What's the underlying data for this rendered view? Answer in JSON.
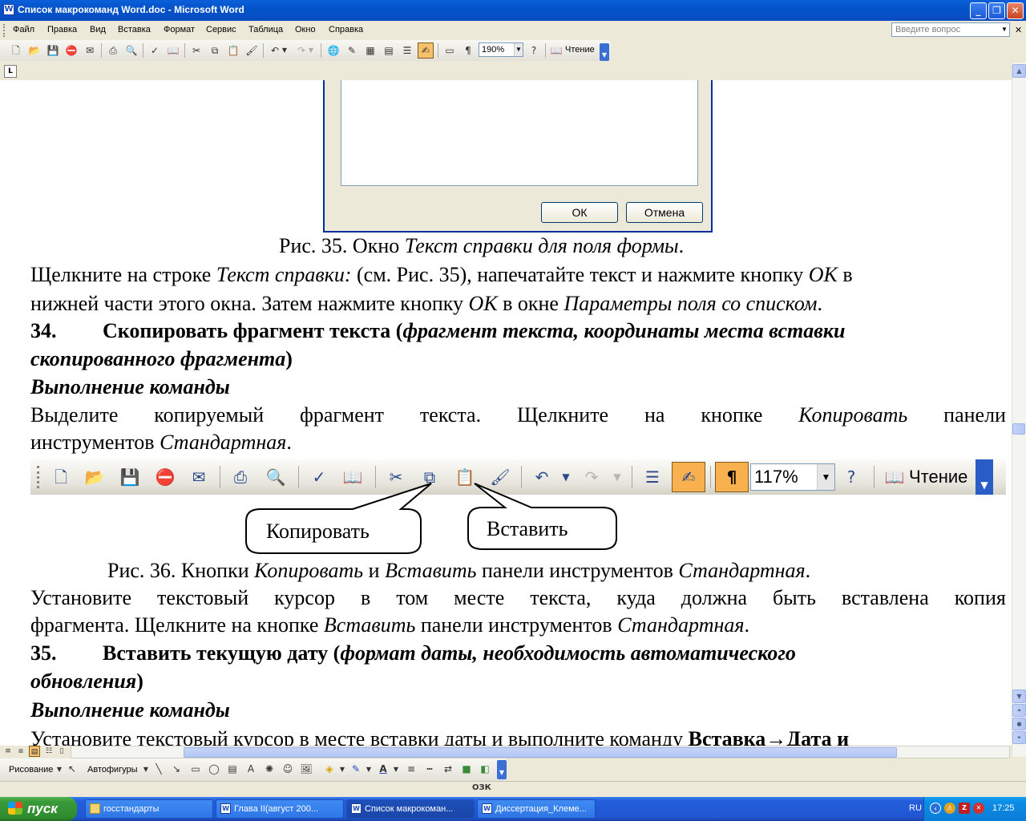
{
  "window": {
    "title": "Список макрокоманд Word.doc - Microsoft Word",
    "minimize": "_",
    "maximize": "❐",
    "close": "✕"
  },
  "menu": {
    "items": [
      "Файл",
      "Правка",
      "Вид",
      "Вставка",
      "Формат",
      "Сервис",
      "Таблица",
      "Окно",
      "Справка"
    ],
    "ask_placeholder": "Введите вопрос",
    "close_doc": "✕"
  },
  "toolbar": {
    "zoom": "190%",
    "reading": "Чтение"
  },
  "dialog": {
    "ok": "ОК",
    "cancel": "Отмена"
  },
  "document": {
    "fig35_caption_a": "Рис. 35. Окно ",
    "fig35_caption_b": "Текст справки для поля формы",
    "fig35_caption_c": ".",
    "p1_a": "Щелкните на строке ",
    "p1_b": "Текст справки:",
    "p1_c": " (см. Рис. 35), напечатайте текст и нажмите кнопку ",
    "p1_d": "ОК",
    "p1_e": " в",
    "p2_a": "нижней части этого окна. Затем нажмите кнопку ",
    "p2_b": "ОК",
    "p2_c": " в окне ",
    "p2_d": "Параметры поля со списком",
    "p2_e": ".",
    "h34_num": "34.",
    "h34_a": "Скопировать фрагмент текста (",
    "h34_b": "фрагмент текста, координаты места вставки",
    "h34_c": "скопированного фрагмента",
    "h34_d": ")",
    "exec1": "Выполнение команды",
    "p3_a": "Выделите",
    "p3_b": "копируемый",
    "p3_c": "фрагмент",
    "p3_d": "текста.",
    "p3_e": "Щелкните",
    "p3_f": "на",
    "p3_g": "кнопке",
    "p3_h": "Копировать",
    "p3_i": "панели",
    "p4_a": "инструментов ",
    "p4_b": "Стандартная",
    "p4_c": ".",
    "big_zoom": "117%",
    "big_reading": "Чтение",
    "callout_copy": "Копировать",
    "callout_paste": "Вставить",
    "fig36_a": "Рис. 36. Кнопки ",
    "fig36_b": "Копировать",
    "fig36_c": " и ",
    "fig36_d": "Вставить",
    "fig36_e": " панели инструментов ",
    "fig36_f": "Стандартная",
    "fig36_g": ".",
    "p5_words": [
      "Установите",
      "текстовый",
      "курсор",
      "в",
      "том",
      "месте",
      "текста,",
      "куда",
      "должна",
      "быть",
      "вставлена",
      "копия"
    ],
    "p6_a": "фрагмента. Щелкните на кнопке ",
    "p6_b": "Вставить",
    "p6_c": " панели инструментов ",
    "p6_d": "Стандартная",
    "p6_e": ".",
    "h35_num": "35.",
    "h35_a": "Вставить текущую дату (",
    "h35_b": "формат даты, необходимость автоматического",
    "h35_c": "обновления",
    "h35_d": ")",
    "exec2": "Выполнение команды",
    "p7_a": "Установите текстовый курсор в месте вставки даты и выполните команду ",
    "p7_b": "Вставка→Дата и"
  },
  "drawing": {
    "draw": "Рисование",
    "autoshapes": "Автофигуры"
  },
  "status": {
    "indicator": "ОЗК"
  },
  "taskbar": {
    "start": "пуск",
    "tasks": [
      "госстандарты",
      "Глава II(август 200...",
      "Список макрокоман...",
      "Диссертация_Клеме..."
    ],
    "lang": "RU",
    "time": "17:25"
  }
}
